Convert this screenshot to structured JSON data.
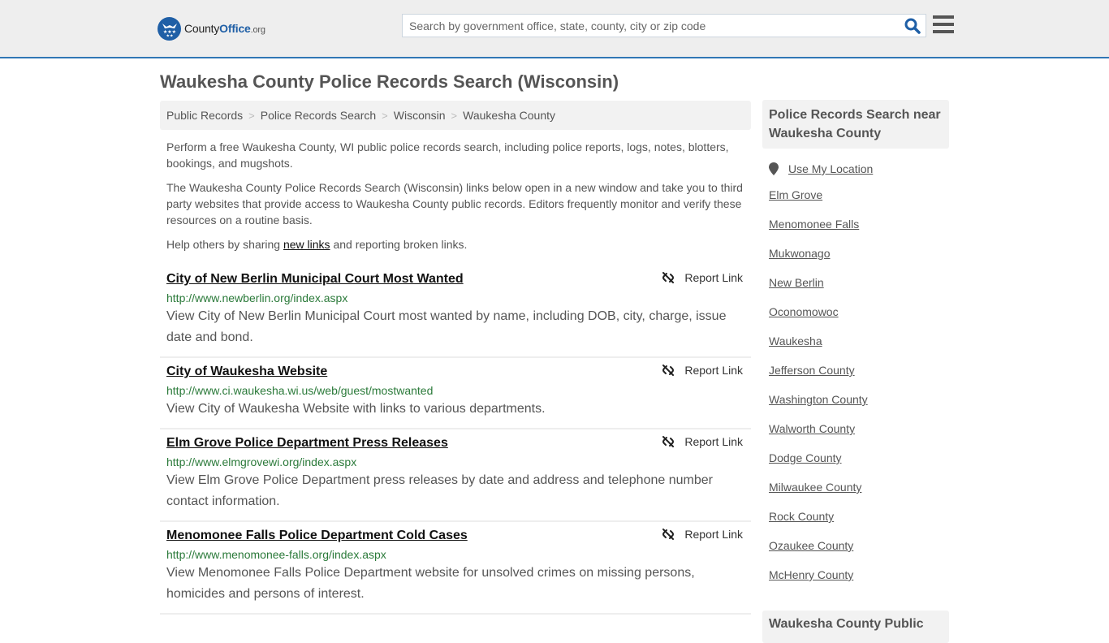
{
  "header": {
    "logo": {
      "prefix": "County",
      "brand": "Office",
      "suffix": ".org"
    },
    "search": {
      "placeholder": "Search by government office, state, county, city or zip code",
      "value": ""
    },
    "search_icon": "search-icon",
    "menu_icon": "hamburger-menu-icon"
  },
  "page": {
    "title": "Waukesha County Police Records Search (Wisconsin)"
  },
  "breadcrumb": [
    "Public Records",
    "Police Records Search",
    "Wisconsin",
    "Waukesha County"
  ],
  "intro": {
    "p1": "Perform a free Waukesha County, WI public police records search, including police reports, logs, notes, blotters, bookings, and mugshots.",
    "p2": "The Waukesha County Police Records Search (Wisconsin) links below open in a new window and take you to third party websites that provide access to Waukesha County public records. Editors frequently monitor and verify these resources on a routine basis.",
    "p3_before": "Help others by sharing ",
    "p3_link": "new links",
    "p3_after": " and reporting broken links."
  },
  "results": [
    {
      "title": "City of New Berlin Municipal Court Most Wanted",
      "url": "http://www.newberlin.org/index.aspx",
      "description": "View City of New Berlin Municipal Court most wanted by name, including DOB, city, charge, issue date and bond.",
      "report_label": "Report Link"
    },
    {
      "title": "City of Waukesha Website",
      "url": "http://www.ci.waukesha.wi.us/web/guest/mostwanted",
      "description": "View City of Waukesha Website with links to various departments.",
      "report_label": "Report Link"
    },
    {
      "title": "Elm Grove Police Department Press Releases",
      "url": "http://www.elmgrovewi.org/index.aspx",
      "description": "View Elm Grove Police Department press releases by date and address and telephone number contact information.",
      "report_label": "Report Link"
    },
    {
      "title": "Menomonee Falls Police Department Cold Cases",
      "url": "http://www.menomonee-falls.org/index.aspx",
      "description": "View Menomonee Falls Police Department website for unsolved crimes on missing persons, homicides and persons of interest.",
      "report_label": "Report Link"
    }
  ],
  "sidebar": {
    "heading": "Police Records Search near Waukesha County",
    "use_location": "Use My Location",
    "links": [
      "Elm Grove",
      "Menomonee Falls",
      "Mukwonago",
      "New Berlin",
      "Oconomowoc",
      "Waukesha",
      "Jefferson County",
      "Washington County",
      "Walworth County",
      "Dodge County",
      "Milwaukee County",
      "Rock County",
      "Ozaukee County",
      "McHenry County"
    ],
    "heading2": "Waukesha County Public"
  }
}
